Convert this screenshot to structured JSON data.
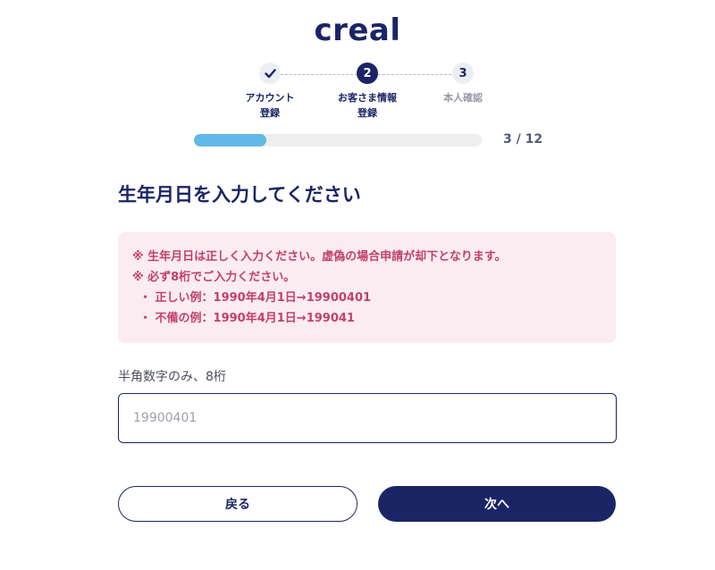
{
  "logo": {
    "text": "creal"
  },
  "stepper": {
    "steps": [
      {
        "icon": "check-icon",
        "label": "アカウント\n登録",
        "state": "done"
      },
      {
        "number": "2",
        "label": "お客さま情報\n登録",
        "state": "active"
      },
      {
        "number": "3",
        "label": "本人確認",
        "state": "todo"
      }
    ]
  },
  "progress": {
    "text": "3 / 12",
    "fraction": 0.25,
    "color": "#62b8e6"
  },
  "form": {
    "heading": "生年月日を入力してください",
    "notice": {
      "lines": [
        "※ 生年月日は正しく入力ください。虚偽の場合申請が却下となります。",
        "※ 必ず8桁でご入力ください。"
      ],
      "bullets": [
        "・ 正しい例：1990年4月1日→19900401",
        "・ 不備の例：1990年4月1日→199041"
      ]
    },
    "field_label": "半角数字のみ、8桁",
    "input": {
      "placeholder": "19900401",
      "value": ""
    }
  },
  "buttons": {
    "back": "戻る",
    "next": "次へ"
  },
  "colors": {
    "brand": "#1b2566",
    "notice_text": "#c2406e",
    "notice_bg": "#fbecf1"
  }
}
